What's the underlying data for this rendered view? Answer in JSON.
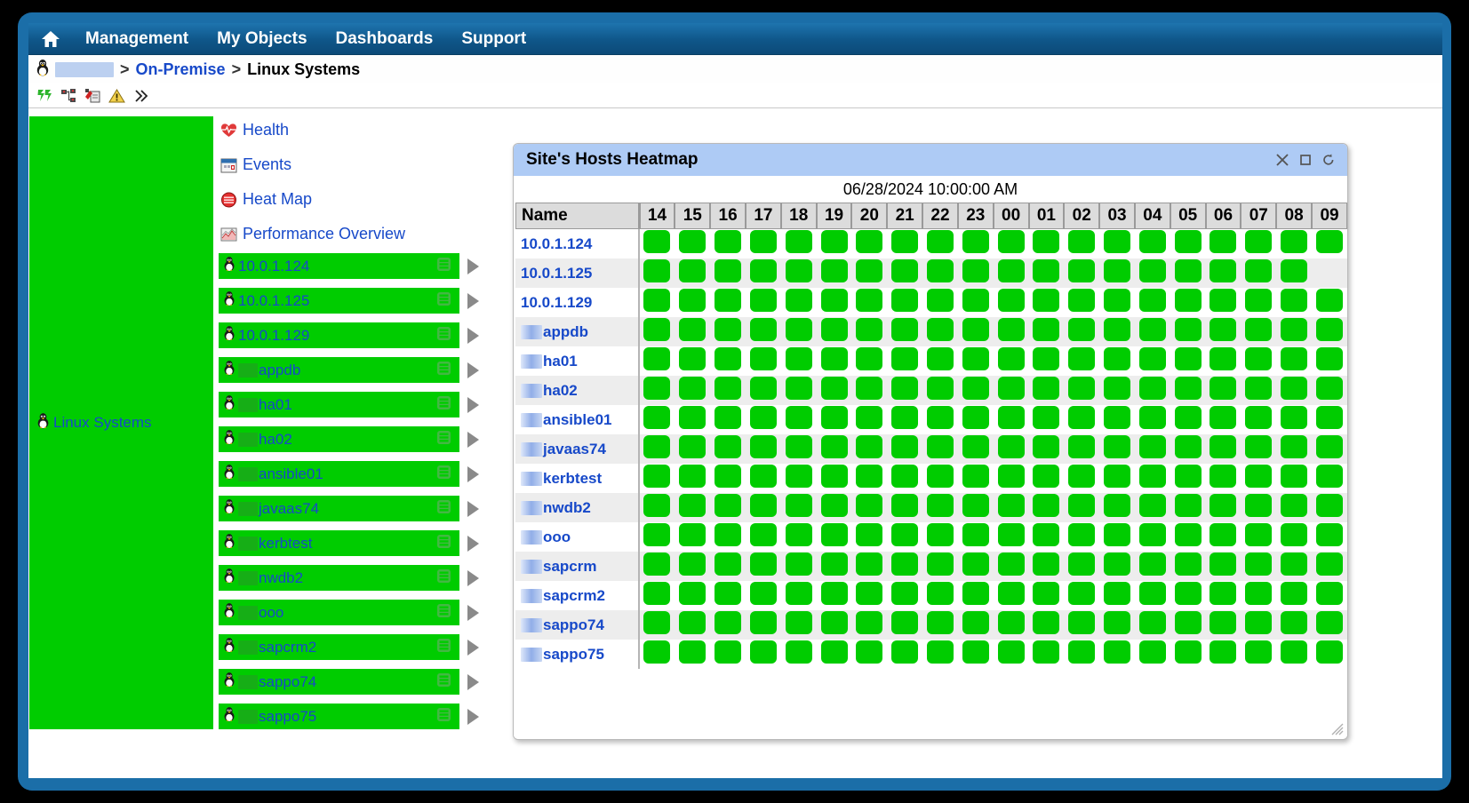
{
  "topnav": {
    "home_icon": "home-icon",
    "items": [
      {
        "label": "Management"
      },
      {
        "label": "My Objects"
      },
      {
        "label": "Dashboards"
      },
      {
        "label": "Support"
      }
    ]
  },
  "breadcrumb": {
    "leading_icon": "linux-penguin-icon",
    "redacted_site": "",
    "sep1": ">",
    "link": "On-Premise",
    "sep2": ">",
    "current": "Linux Systems"
  },
  "toolbar": {
    "icons": [
      "refresh-icon",
      "topology-icon",
      "device-config-icon",
      "warning-icon",
      "more-chevrons-icon"
    ]
  },
  "group_panel": {
    "icon": "linux-penguin-icon",
    "label": "Linux Systems",
    "color": "#00cc00"
  },
  "tree": {
    "links": [
      {
        "label": "Health",
        "icon": "heart-pulse-icon"
      },
      {
        "label": "Events",
        "icon": "calendar-icon"
      },
      {
        "label": "Heat Map",
        "icon": "heatmap-circle-icon"
      },
      {
        "label": "Performance Overview",
        "icon": "performance-chart-icon"
      }
    ],
    "hosts": [
      {
        "name": "10.0.1.124",
        "redacted": false
      },
      {
        "name": "10.0.1.125",
        "redacted": false
      },
      {
        "name": "10.0.1.129",
        "redacted": false
      },
      {
        "name": "appdb",
        "redacted": true
      },
      {
        "name": "ha01",
        "redacted": true
      },
      {
        "name": "ha02",
        "redacted": true
      },
      {
        "name": "ansible01",
        "redacted": true
      },
      {
        "name": "javaas74",
        "redacted": true
      },
      {
        "name": "kerbtest",
        "redacted": true
      },
      {
        "name": "nwdb2",
        "redacted": true
      },
      {
        "name": "ooo",
        "redacted": true
      },
      {
        "name": "sapcrm2",
        "redacted": true
      },
      {
        "name": "sappo74",
        "redacted": true
      },
      {
        "name": "sappo75",
        "redacted": true
      }
    ]
  },
  "heatmap_window": {
    "title": "Site's Hosts Heatmap",
    "date": "06/28/2024 10:00:00 AM",
    "controls": [
      {
        "name": "close-icon",
        "glyph": "✕"
      },
      {
        "name": "maximize-icon",
        "glyph": "□"
      },
      {
        "name": "refresh-icon",
        "glyph": "⟳"
      }
    ],
    "name_column_header": "Name",
    "hours": [
      "14",
      "15",
      "16",
      "17",
      "18",
      "19",
      "20",
      "21",
      "22",
      "23",
      "00",
      "01",
      "02",
      "03",
      "04",
      "05",
      "06",
      "07",
      "08",
      "09"
    ],
    "status_color_ok": "#00cc00",
    "status_color_empty": "#ededed",
    "rows": [
      {
        "name": "10.0.1.124",
        "redacted": false,
        "cells": [
          "ok",
          "ok",
          "ok",
          "ok",
          "ok",
          "ok",
          "ok",
          "ok",
          "ok",
          "ok",
          "ok",
          "ok",
          "ok",
          "ok",
          "ok",
          "ok",
          "ok",
          "ok",
          "ok",
          "ok"
        ]
      },
      {
        "name": "10.0.1.125",
        "redacted": false,
        "cells": [
          "ok",
          "ok",
          "ok",
          "ok",
          "ok",
          "ok",
          "ok",
          "ok",
          "ok",
          "ok",
          "ok",
          "ok",
          "ok",
          "ok",
          "ok",
          "ok",
          "ok",
          "ok",
          "ok",
          "none"
        ]
      },
      {
        "name": "10.0.1.129",
        "redacted": false,
        "cells": [
          "ok",
          "ok",
          "ok",
          "ok",
          "ok",
          "ok",
          "ok",
          "ok",
          "ok",
          "ok",
          "ok",
          "ok",
          "ok",
          "ok",
          "ok",
          "ok",
          "ok",
          "ok",
          "ok",
          "ok"
        ]
      },
      {
        "name": "appdb",
        "redacted": true,
        "cells": [
          "ok",
          "ok",
          "ok",
          "ok",
          "ok",
          "ok",
          "ok",
          "ok",
          "ok",
          "ok",
          "ok",
          "ok",
          "ok",
          "ok",
          "ok",
          "ok",
          "ok",
          "ok",
          "ok",
          "ok"
        ]
      },
      {
        "name": "ha01",
        "redacted": true,
        "cells": [
          "ok",
          "ok",
          "ok",
          "ok",
          "ok",
          "ok",
          "ok",
          "ok",
          "ok",
          "ok",
          "ok",
          "ok",
          "ok",
          "ok",
          "ok",
          "ok",
          "ok",
          "ok",
          "ok",
          "ok"
        ]
      },
      {
        "name": "ha02",
        "redacted": true,
        "cells": [
          "ok",
          "ok",
          "ok",
          "ok",
          "ok",
          "ok",
          "ok",
          "ok",
          "ok",
          "ok",
          "ok",
          "ok",
          "ok",
          "ok",
          "ok",
          "ok",
          "ok",
          "ok",
          "ok",
          "ok"
        ]
      },
      {
        "name": "ansible01",
        "redacted": true,
        "cells": [
          "ok",
          "ok",
          "ok",
          "ok",
          "ok",
          "ok",
          "ok",
          "ok",
          "ok",
          "ok",
          "ok",
          "ok",
          "ok",
          "ok",
          "ok",
          "ok",
          "ok",
          "ok",
          "ok",
          "ok"
        ]
      },
      {
        "name": "javaas74",
        "redacted": true,
        "cells": [
          "ok",
          "ok",
          "ok",
          "ok",
          "ok",
          "ok",
          "ok",
          "ok",
          "ok",
          "ok",
          "ok",
          "ok",
          "ok",
          "ok",
          "ok",
          "ok",
          "ok",
          "ok",
          "ok",
          "ok"
        ]
      },
      {
        "name": "kerbtest",
        "redacted": true,
        "cells": [
          "ok",
          "ok",
          "ok",
          "ok",
          "ok",
          "ok",
          "ok",
          "ok",
          "ok",
          "ok",
          "ok",
          "ok",
          "ok",
          "ok",
          "ok",
          "ok",
          "ok",
          "ok",
          "ok",
          "ok"
        ]
      },
      {
        "name": "nwdb2",
        "redacted": true,
        "cells": [
          "ok",
          "ok",
          "ok",
          "ok",
          "ok",
          "ok",
          "ok",
          "ok",
          "ok",
          "ok",
          "ok",
          "ok",
          "ok",
          "ok",
          "ok",
          "ok",
          "ok",
          "ok",
          "ok",
          "ok"
        ]
      },
      {
        "name": "ooo",
        "redacted": true,
        "cells": [
          "ok",
          "ok",
          "ok",
          "ok",
          "ok",
          "ok",
          "ok",
          "ok",
          "ok",
          "ok",
          "ok",
          "ok",
          "ok",
          "ok",
          "ok",
          "ok",
          "ok",
          "ok",
          "ok",
          "ok"
        ]
      },
      {
        "name": "sapcrm",
        "redacted": true,
        "cells": [
          "ok",
          "ok",
          "ok",
          "ok",
          "ok",
          "ok",
          "ok",
          "ok",
          "ok",
          "ok",
          "ok",
          "ok",
          "ok",
          "ok",
          "ok",
          "ok",
          "ok",
          "ok",
          "ok",
          "ok"
        ]
      },
      {
        "name": "sapcrm2",
        "redacted": true,
        "cells": [
          "ok",
          "ok",
          "ok",
          "ok",
          "ok",
          "ok",
          "ok",
          "ok",
          "ok",
          "ok",
          "ok",
          "ok",
          "ok",
          "ok",
          "ok",
          "ok",
          "ok",
          "ok",
          "ok",
          "ok"
        ]
      },
      {
        "name": "sappo74",
        "redacted": true,
        "cells": [
          "ok",
          "ok",
          "ok",
          "ok",
          "ok",
          "ok",
          "ok",
          "ok",
          "ok",
          "ok",
          "ok",
          "ok",
          "ok",
          "ok",
          "ok",
          "ok",
          "ok",
          "ok",
          "ok",
          "ok"
        ]
      },
      {
        "name": "sappo75",
        "redacted": true,
        "cells": [
          "ok",
          "ok",
          "ok",
          "ok",
          "ok",
          "ok",
          "ok",
          "ok",
          "ok",
          "ok",
          "ok",
          "ok",
          "ok",
          "ok",
          "ok",
          "ok",
          "ok",
          "ok",
          "ok",
          "ok"
        ]
      }
    ]
  }
}
